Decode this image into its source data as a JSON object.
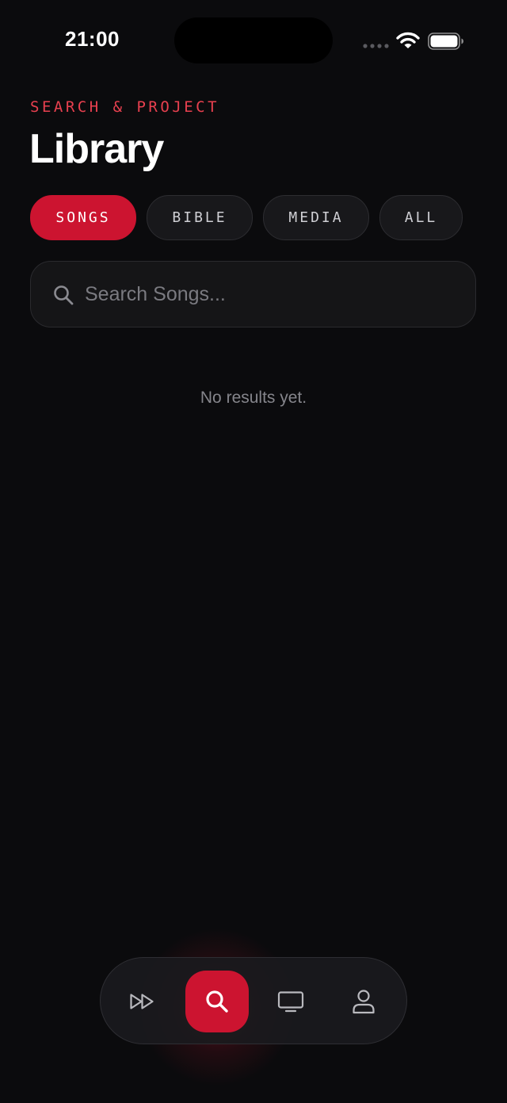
{
  "status_bar": {
    "time": "21:00"
  },
  "header": {
    "eyebrow": "SEARCH & PROJECT",
    "title": "Library"
  },
  "tabs": [
    {
      "label": "SONGS",
      "active": true
    },
    {
      "label": "BIBLE",
      "active": false
    },
    {
      "label": "MEDIA",
      "active": false
    },
    {
      "label": "ALL",
      "active": false
    }
  ],
  "search": {
    "placeholder": "Search Songs...",
    "value": ""
  },
  "empty_state": {
    "message": "No results yet."
  },
  "bottom_nav": {
    "items": [
      {
        "icon": "fast-forward-icon",
        "active": false
      },
      {
        "icon": "search-icon",
        "active": true
      },
      {
        "icon": "display-icon",
        "active": false
      },
      {
        "icon": "profile-icon",
        "active": false
      }
    ]
  },
  "colors": {
    "accent": "#cc1430",
    "eyebrow": "#e8404f",
    "background": "#0b0b0d"
  }
}
